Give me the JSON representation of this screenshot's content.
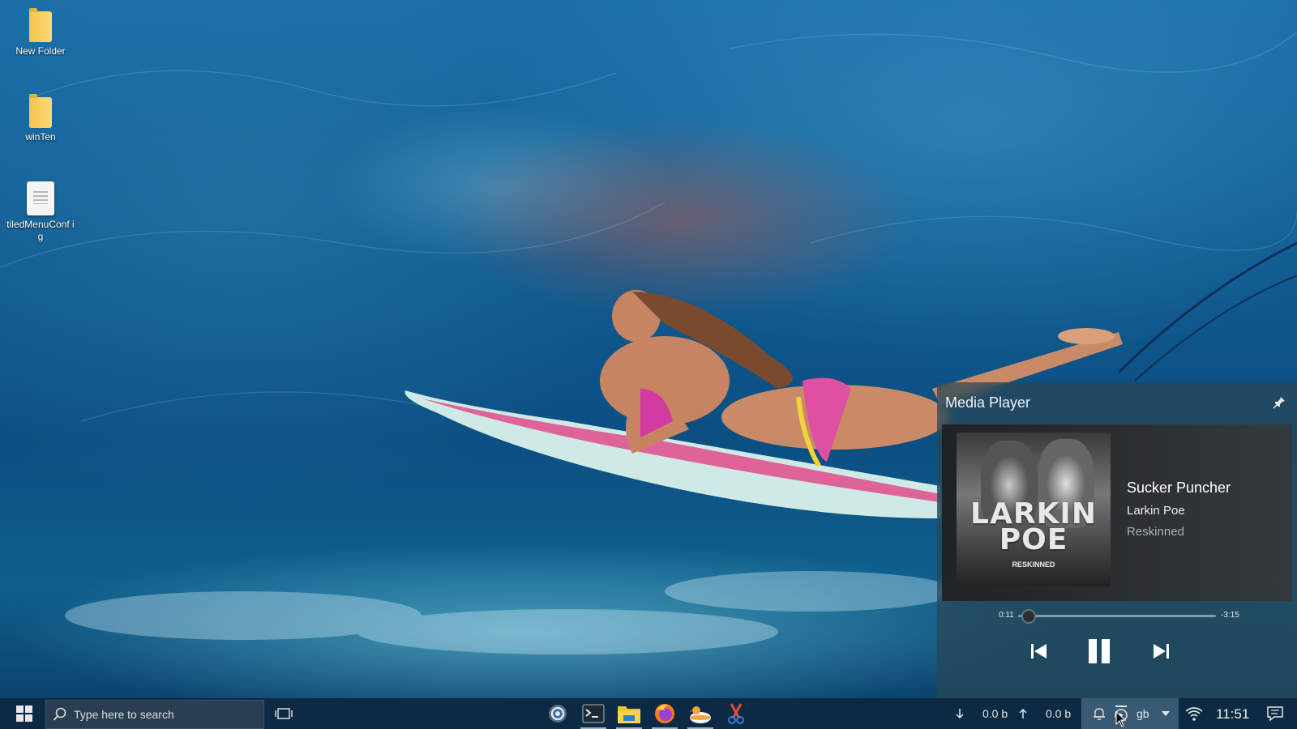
{
  "desktop": {
    "icons": [
      {
        "label": "New Folder",
        "type": "folder-icon"
      },
      {
        "label": "winTen",
        "type": "folder-icon"
      },
      {
        "label": "tiledMenuConf ig",
        "type": "file-icon"
      }
    ]
  },
  "media_player": {
    "title": "Media Player",
    "track": {
      "title": "Sucker Puncher",
      "artist": "Larkin Poe",
      "album": "Reskinned"
    },
    "cover": {
      "line1": "LARKIN",
      "line2": "POE",
      "album_text": "RESKINNED"
    },
    "position": {
      "current": "0:11",
      "remaining": "-3:15",
      "progress_fraction": 0.055
    },
    "controls": {
      "previous": "skip-previous-icon",
      "play_pause": "pause-icon",
      "next": "skip-next-icon"
    },
    "accent_color": "#3daee9"
  },
  "taskbar": {
    "search_placeholder": "Type here to search",
    "apps": [
      "settings-icon",
      "terminal-icon",
      "file-manager-icon",
      "firefox-icon",
      "duck-app-icon",
      "scissors-app-icon"
    ],
    "network": {
      "down_speed": "0.0 b",
      "up_speed": "0.0 b"
    },
    "keyboard_layout": "gb",
    "clock": "11:51"
  }
}
